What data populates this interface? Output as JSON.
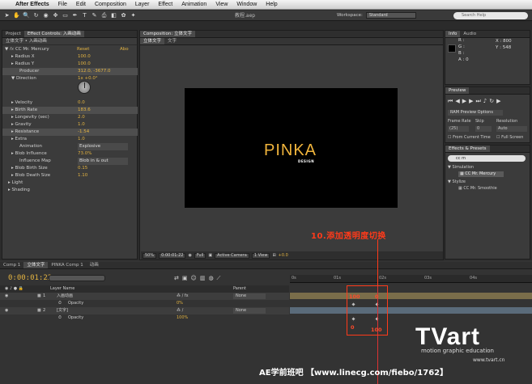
{
  "menubar": {
    "app_name": "After Effects",
    "items": [
      "File",
      "Edit",
      "Composition",
      "Layer",
      "Effect",
      "Animation",
      "View",
      "Window",
      "Help"
    ]
  },
  "toolbar": {
    "doc_title": "教程.aep",
    "workspace_label": "Workspace:",
    "workspace_value": "Standard",
    "search_placeholder": "Search Help"
  },
  "project_panel": {
    "tabs": [
      "Project",
      "Effect Controls: 入画动画"
    ],
    "breadcrumb": "立体文字 • 入画动画"
  },
  "effect_controls": {
    "effect_name": "CC Mr. Mercury",
    "reset": "Reset",
    "about": "Abo",
    "rows": [
      {
        "label": "Radius X",
        "value": "100.0"
      },
      {
        "label": "Radius Y",
        "value": "100.0"
      },
      {
        "label": "Producer",
        "value": "312.0, -3677.0"
      },
      {
        "label": "Direction",
        "value": "1x +0.0°"
      },
      {
        "label": "Velocity",
        "value": "0.0"
      },
      {
        "label": "Birth Rate",
        "value": "183.6"
      },
      {
        "label": "Longevity (sec)",
        "value": "2.0"
      },
      {
        "label": "Gravity",
        "value": "1.0"
      },
      {
        "label": "Resistance",
        "value": "-1.54"
      },
      {
        "label": "Extra",
        "value": "1.0"
      },
      {
        "label": "Animation",
        "value": "Explosive"
      },
      {
        "label": "Blob Influence",
        "value": "73.0%"
      },
      {
        "label": "Influence Map",
        "value": "Blob in & out"
      },
      {
        "label": "Blob Birth Size",
        "value": "0.15"
      },
      {
        "label": "Blob Death Size",
        "value": "1.10"
      },
      {
        "label": "Light",
        "value": ""
      },
      {
        "label": "Shading",
        "value": ""
      }
    ]
  },
  "composition": {
    "tab": "Composition: 立体文字",
    "subtabs": [
      "立体文字",
      "文字"
    ],
    "preview_title": "PINKA",
    "preview_sub": "DESIGN",
    "bottom": {
      "zoom": "50%",
      "timecode": "0:00:01:22",
      "quality": "Full",
      "camera": "Active Camera",
      "view": "1 View",
      "offset": "+0.0"
    }
  },
  "info_panel": {
    "tabs": [
      "Info",
      "Audio"
    ],
    "r": "R :",
    "g": "G :",
    "b": "B :",
    "a": "A : 0",
    "x": "X : 800",
    "y": "Y : 548"
  },
  "preview_panel": {
    "title": "Preview",
    "ram_options": "RAM Preview Options",
    "frame_rate_label": "Frame Rate",
    "skip_label": "Skip",
    "resolution_label": "Resolution",
    "frame_rate": "(25)",
    "skip": "0",
    "resolution": "Auto",
    "from_current": "From Current Time",
    "full_screen": "Full Screen"
  },
  "effects_presets": {
    "title": "Effects & Presets",
    "search": "cc m",
    "groups": [
      {
        "name": "Simulation",
        "items": [
          "CC Mr. Mercury"
        ]
      },
      {
        "name": "Stylize",
        "items": [
          "CC Mr. Smoothie"
        ]
      }
    ]
  },
  "timeline": {
    "tabs": [
      "Comp 1",
      "立体文字",
      "PINKA Comp 1",
      "动画"
    ],
    "timecode": "0:00:01:22",
    "col_layer_name": "Layer Name",
    "col_parent": "Parent",
    "layers": [
      {
        "num": "1",
        "name": "入画动画",
        "parent": "None",
        "prop": "Opacity",
        "prop_value": "0%"
      },
      {
        "num": "2",
        "name": "[文字]",
        "parent": "None",
        "prop": "Opacity",
        "prop_value": "100%"
      }
    ],
    "ruler_labels": [
      "0s",
      "01s",
      "02s",
      "03s",
      "04s"
    ],
    "key_values": [
      "100",
      "0",
      "0",
      "100"
    ]
  },
  "annotation": "10.添加透明度切换",
  "watermark": {
    "brand": "TVart",
    "subtitle": "motion graphic education",
    "url": "www.tvart.cn",
    "footer": "AE学前班吧 【www.linecg.com/fiebo/1762】"
  },
  "colors": {
    "accent": "#e3b341",
    "annotation": "#ff3a1a",
    "pinka": "#f0b43c"
  }
}
